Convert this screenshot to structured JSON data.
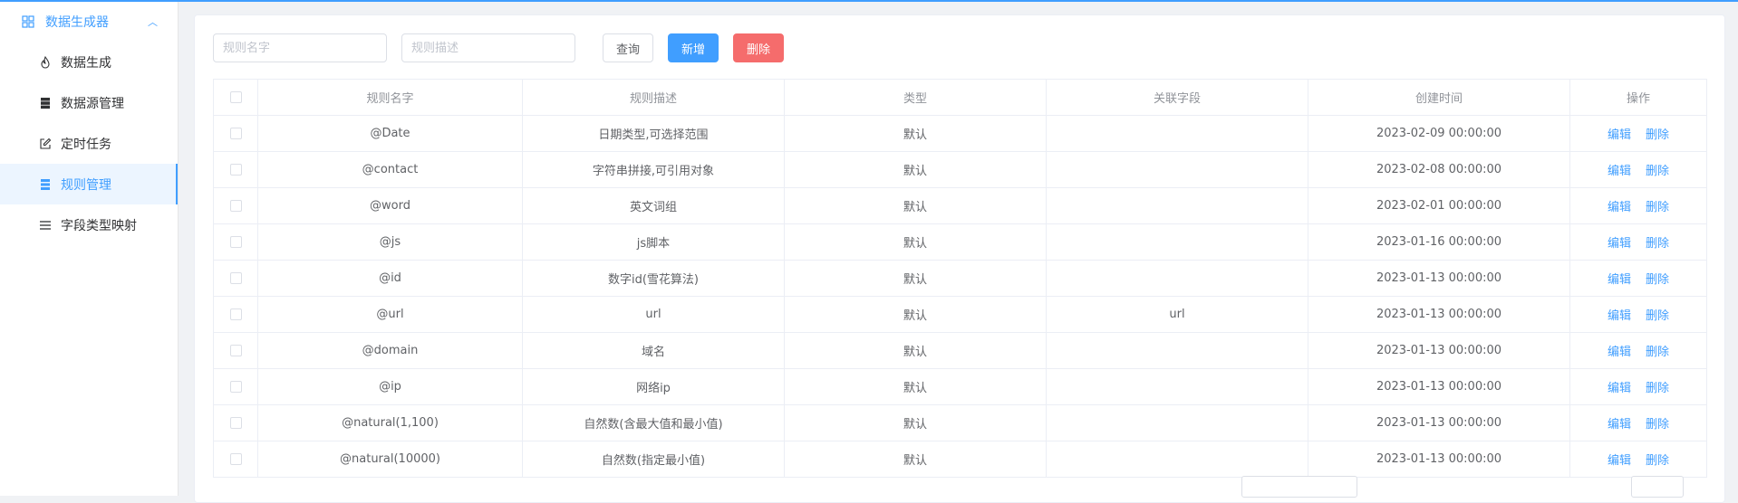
{
  "sidebar": {
    "group_label": "数据生成器",
    "items": [
      {
        "label": "数据生成",
        "icon": "flame-icon",
        "active": false
      },
      {
        "label": "数据源管理",
        "icon": "server-icon",
        "active": false
      },
      {
        "label": "定时任务",
        "icon": "edit-icon",
        "active": false
      },
      {
        "label": "规则管理",
        "icon": "list-icon",
        "active": true
      },
      {
        "label": "字段类型映射",
        "icon": "menu-icon",
        "active": false
      }
    ]
  },
  "toolbar": {
    "name_placeholder": "规则名字",
    "desc_placeholder": "规则描述",
    "query_label": "查询",
    "add_label": "新增",
    "delete_label": "删除"
  },
  "table": {
    "headers": {
      "name": "规则名字",
      "desc": "规则描述",
      "type": "类型",
      "field": "关联字段",
      "time": "创建时间",
      "ops": "操作"
    },
    "edit_label": "编辑",
    "delete_label": "删除",
    "rows": [
      {
        "name": "@Date",
        "desc": "日期类型,可选择范围",
        "type": "默认",
        "field": "",
        "time": "2023-02-09 00:00:00"
      },
      {
        "name": "@contact",
        "desc": "字符串拼接,可引用对象",
        "type": "默认",
        "field": "",
        "time": "2023-02-08 00:00:00"
      },
      {
        "name": "@word",
        "desc": "英文词组",
        "type": "默认",
        "field": "",
        "time": "2023-02-01 00:00:00"
      },
      {
        "name": "@js",
        "desc": "js脚本",
        "type": "默认",
        "field": "",
        "time": "2023-01-16 00:00:00"
      },
      {
        "name": "@id",
        "desc": "数字id(雪花算法)",
        "type": "默认",
        "field": "",
        "time": "2023-01-13 00:00:00"
      },
      {
        "name": "@url",
        "desc": "url",
        "type": "默认",
        "field": "url",
        "time": "2023-01-13 00:00:00"
      },
      {
        "name": "@domain",
        "desc": "域名",
        "type": "默认",
        "field": "",
        "time": "2023-01-13 00:00:00"
      },
      {
        "name": "@ip",
        "desc": "网络ip",
        "type": "默认",
        "field": "",
        "time": "2023-01-13 00:00:00"
      },
      {
        "name": "@natural(1,100)",
        "desc": "自然数(含最大值和最小值)",
        "type": "默认",
        "field": "",
        "time": "2023-01-13 00:00:00"
      },
      {
        "name": "@natural(10000)",
        "desc": "自然数(指定最小值)",
        "type": "默认",
        "field": "",
        "time": "2023-01-13 00:00:00"
      }
    ]
  }
}
